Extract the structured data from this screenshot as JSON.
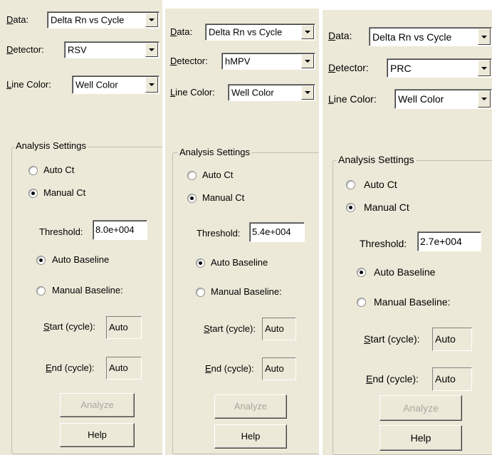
{
  "panels": [
    {
      "data_label": "Data:",
      "data_value": "Delta Rn vs Cycle",
      "detector_label": "Detector:",
      "detector_value": "RSV",
      "line_color_label": "Line Color:",
      "line_color_value": "Well Color",
      "group_title": "Analysis Settings",
      "auto_ct": "Auto Ct",
      "manual_ct": "Manual Ct",
      "threshold_label": "Threshold:",
      "threshold_value": "8.0e+004",
      "auto_baseline": "Auto Baseline",
      "manual_baseline": "Manual Baseline:",
      "start_label": "Start (cycle):",
      "start_value": "Auto",
      "end_label": "End (cycle):",
      "end_value": "Auto",
      "analyze": "Analyze",
      "help": "Help"
    },
    {
      "data_label": "Data:",
      "data_value": "Delta Rn vs Cycle",
      "detector_label": "Detector:",
      "detector_value": "hMPV",
      "line_color_label": "Line Color:",
      "line_color_value": "Well Color",
      "group_title": "Analysis Settings",
      "auto_ct": "Auto Ct",
      "manual_ct": "Manual Ct",
      "threshold_label": "Threshold:",
      "threshold_value": "5.4e+004",
      "auto_baseline": "Auto Baseline",
      "manual_baseline": "Manual Baseline:",
      "start_label": "Start (cycle):",
      "start_value": "Auto",
      "end_label": "End (cycle):",
      "end_value": "Auto",
      "analyze": "Analyze",
      "help": "Help"
    },
    {
      "data_label": "Data:",
      "data_value": "Delta Rn vs Cycle",
      "detector_label": "Detector:",
      "detector_value": "PRC",
      "line_color_label": "Line Color:",
      "line_color_value": "Well Color",
      "group_title": "Analysis Settings",
      "auto_ct": "Auto Ct",
      "manual_ct": "Manual Ct",
      "threshold_label": "Threshold:",
      "threshold_value": "2.7e+004",
      "auto_baseline": "Auto Baseline",
      "manual_baseline": "Manual Baseline:",
      "start_label": "Start (cycle):",
      "start_value": "Auto",
      "end_label": "End (cycle):",
      "end_value": "Auto",
      "analyze": "Analyze",
      "help": "Help"
    }
  ]
}
